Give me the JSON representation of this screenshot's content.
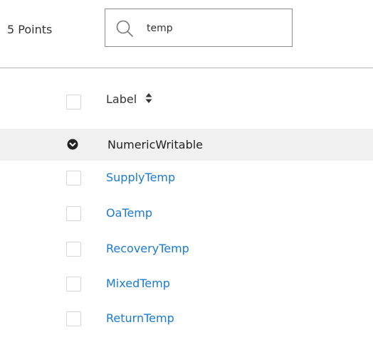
{
  "header": {
    "points_count": "5 Points"
  },
  "search": {
    "value": "temp",
    "placeholder": "",
    "icon": "search-icon"
  },
  "table": {
    "column_label": "Label",
    "sort_icon": "sort-icon",
    "group": {
      "label": "NumericWritable",
      "icon": "chevron-down-icon"
    },
    "rows": [
      {
        "label": "SupplyTemp"
      },
      {
        "label": "OaTemp"
      },
      {
        "label": "RecoveryTemp"
      },
      {
        "label": "MixedTemp"
      },
      {
        "label": "ReturnTemp"
      }
    ]
  },
  "colors": {
    "link": "#1a7ad1",
    "group_background": "#f0f0f0",
    "text": "#333333",
    "divider": "#b3b3b3"
  }
}
